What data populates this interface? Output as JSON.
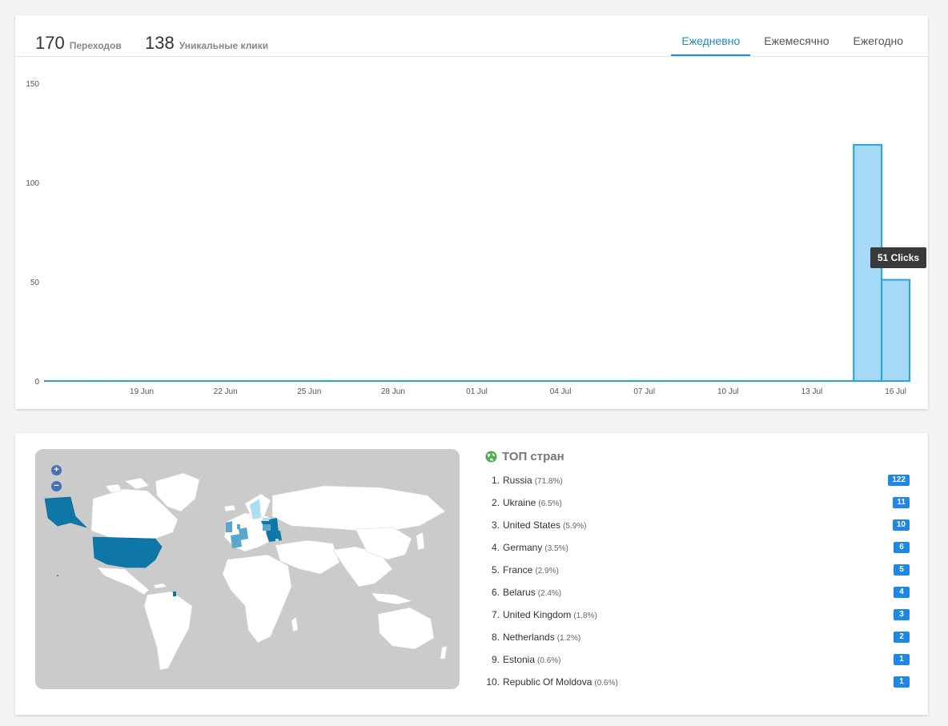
{
  "stats": {
    "clicks_value": "170",
    "clicks_label": "Переходов",
    "unique_value": "138",
    "unique_label": "Уникальные клики"
  },
  "tabs": [
    {
      "label": "Ежедневно",
      "active": true
    },
    {
      "label": "Ежемесячно",
      "active": false
    },
    {
      "label": "Ежегодно",
      "active": false
    }
  ],
  "colors": {
    "accent": "#1e88d0",
    "bar_fill": "#a6d8f8",
    "bar_stroke": "#29a3db",
    "badge": "#1e88e5",
    "map_dark": "#0f77a8",
    "map_mid": "#5aa6cc",
    "map_light": "#aedcf3"
  },
  "chart_data": {
    "type": "bar",
    "x": [
      "16 Jun",
      "17 Jun",
      "18 Jun",
      "19 Jun",
      "20 Jun",
      "21 Jun",
      "22 Jun",
      "23 Jun",
      "24 Jun",
      "25 Jun",
      "26 Jun",
      "27 Jun",
      "28 Jun",
      "29 Jun",
      "30 Jun",
      "01 Jul",
      "02 Jul",
      "03 Jul",
      "04 Jul",
      "05 Jul",
      "06 Jul",
      "07 Jul",
      "08 Jul",
      "09 Jul",
      "10 Jul",
      "11 Jul",
      "12 Jul",
      "13 Jul",
      "14 Jul",
      "15 Jul",
      "16 Jul"
    ],
    "values": [
      0,
      0,
      0,
      0,
      0,
      0,
      0,
      0,
      0,
      0,
      0,
      0,
      0,
      0,
      0,
      0,
      0,
      0,
      0,
      0,
      0,
      0,
      0,
      0,
      0,
      0,
      0,
      0,
      0,
      119,
      51
    ],
    "x_tick_labels": [
      "19 Jun",
      "22 Jun",
      "25 Jun",
      "28 Jun",
      "01 Jul",
      "04 Jul",
      "07 Jul",
      "10 Jul",
      "13 Jul",
      "16 Jul"
    ],
    "y_ticks": [
      0,
      50,
      100,
      150
    ],
    "ylim": [
      0,
      150
    ],
    "grid": false,
    "tooltip": "51 Clicks"
  },
  "map": {
    "zoom_in_label": "+",
    "zoom_out_label": "−"
  },
  "geo": {
    "title": "ТОП стран",
    "icon": "globe-icon",
    "countries": [
      {
        "rank": "1.",
        "name": "Russia",
        "pct": "(71.8%)",
        "count": "122"
      },
      {
        "rank": "2.",
        "name": "Ukraine",
        "pct": "(6.5%)",
        "count": "11"
      },
      {
        "rank": "3.",
        "name": "United States",
        "pct": "(5.9%)",
        "count": "10"
      },
      {
        "rank": "4.",
        "name": "Germany",
        "pct": "(3.5%)",
        "count": "6"
      },
      {
        "rank": "5.",
        "name": "France",
        "pct": "(2.9%)",
        "count": "5"
      },
      {
        "rank": "6.",
        "name": "Belarus",
        "pct": "(2.4%)",
        "count": "4"
      },
      {
        "rank": "7.",
        "name": "United Kingdom",
        "pct": "(1.8%)",
        "count": "3"
      },
      {
        "rank": "8.",
        "name": "Netherlands",
        "pct": "(1.2%)",
        "count": "2"
      },
      {
        "rank": "9.",
        "name": "Estonia",
        "pct": "(0.6%)",
        "count": "1"
      },
      {
        "rank": "10.",
        "name": "Republic Of Moldova",
        "pct": "(0.6%)",
        "count": "1"
      }
    ]
  }
}
